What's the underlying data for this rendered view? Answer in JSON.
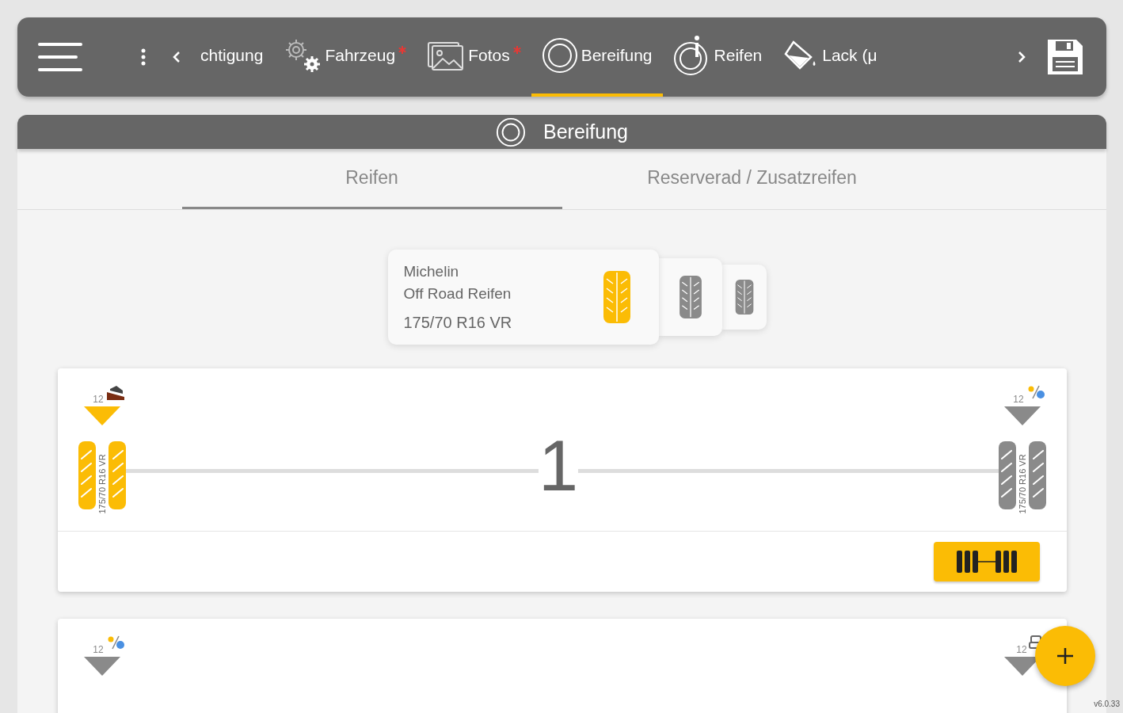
{
  "toolbar": {
    "tabs": [
      {
        "kind": "plain",
        "label": "chtigung",
        "required": false,
        "selected": false
      },
      {
        "kind": "gears",
        "label": "Fahrzeug",
        "required": true,
        "selected": false
      },
      {
        "kind": "photos",
        "label": "Fotos",
        "required": true,
        "selected": false
      },
      {
        "kind": "ring",
        "label": "Bereifung",
        "required": false,
        "selected": true
      },
      {
        "kind": "gauge",
        "label": "Reifen",
        "required": false,
        "selected": false
      },
      {
        "kind": "paint",
        "label": "Lack (μ",
        "required": false,
        "selected": false
      }
    ]
  },
  "section": {
    "title": "Bereifung"
  },
  "subtabs": [
    {
      "label": "Reifen",
      "selected": true
    },
    {
      "label": "Reserverad / Zusatzreifen",
      "selected": false
    }
  ],
  "tire_stack": {
    "brand": "Michelin",
    "model": "Off Road Reifen",
    "size": "175/70 R16 VR",
    "cards": [
      {
        "selected": true
      },
      {
        "selected": false
      },
      {
        "selected": false
      }
    ]
  },
  "axles": [
    {
      "number": "1",
      "twin": true,
      "wheels": [
        {
          "depth": "12",
          "kind": "offroad",
          "selected": true,
          "size": "175/70 R16 VR"
        },
        {
          "depth": "12",
          "kind": "allseason",
          "selected": false,
          "size": "175/70 R16 VR"
        }
      ]
    },
    {
      "wheels": [
        {
          "depth": "12",
          "kind": "allseason",
          "selected": false
        },
        {
          "depth": "12",
          "kind": "car",
          "selected": false
        }
      ]
    }
  ],
  "version": "v6.0.33"
}
